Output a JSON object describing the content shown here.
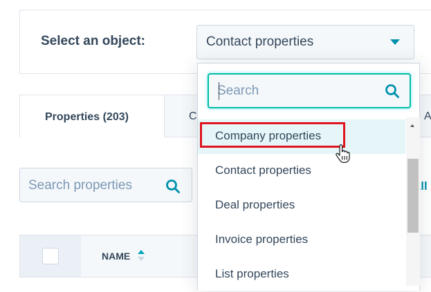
{
  "object_selector": {
    "label": "Select an object:",
    "value": "Contact properties"
  },
  "tabs": {
    "properties_label": "Properties (203)",
    "partial_tab_c": "C",
    "partial_tab_a": "A"
  },
  "search_properties": {
    "placeholder": "Search properties"
  },
  "all_link": "All",
  "table": {
    "name_header": "NAME"
  },
  "dropdown": {
    "search_placeholder": "Search",
    "options": [
      {
        "label": "Company properties"
      },
      {
        "label": "Contact properties"
      },
      {
        "label": "Deal properties"
      },
      {
        "label": "Invoice properties"
      },
      {
        "label": "List properties"
      }
    ]
  },
  "colors": {
    "accent": "#0091ae",
    "focus_border": "#00bda5",
    "highlight_annotation": "#e0141e",
    "hover_row": "#e5f5f8"
  }
}
